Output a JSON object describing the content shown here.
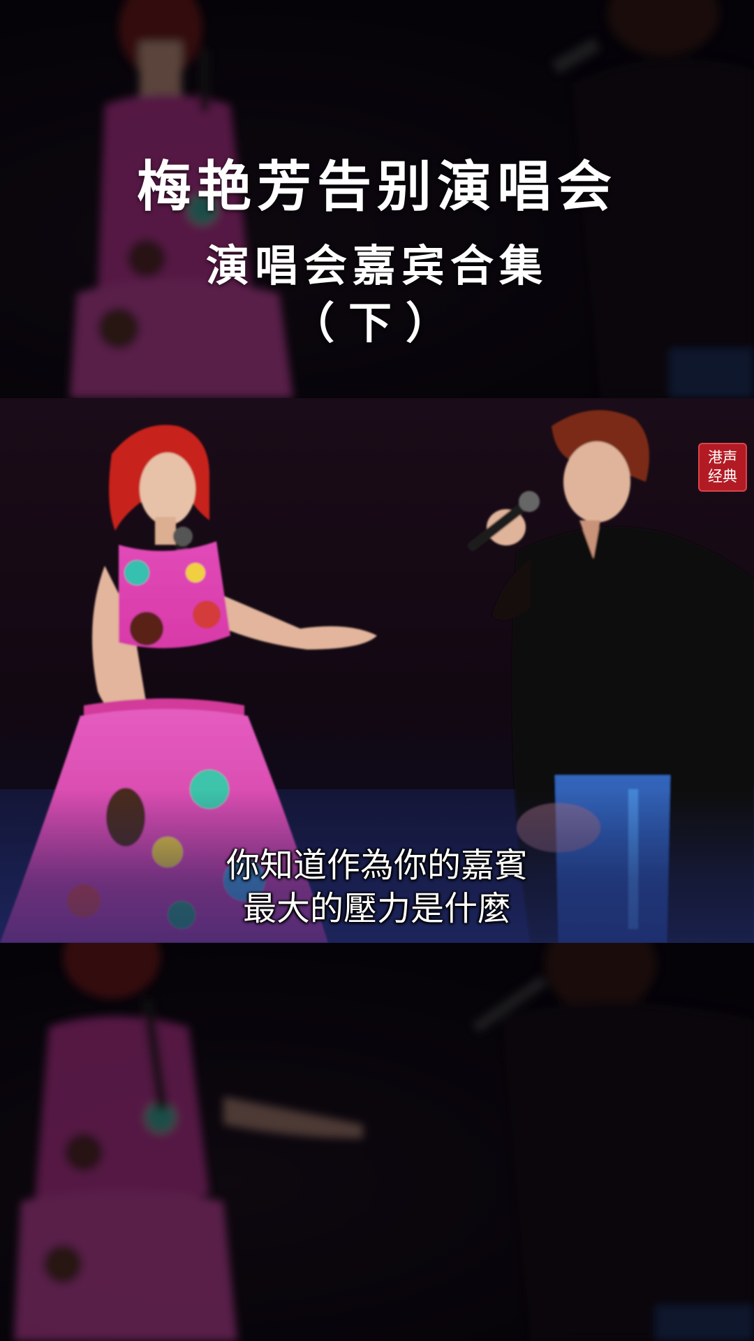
{
  "title": {
    "main": "梅艳芳告别演唱会",
    "sub": "演唱会嘉宾合集",
    "part": "（下）"
  },
  "subtitle": {
    "line1": "你知道作為你的嘉賓",
    "line2": "最大的壓力是什麼"
  },
  "watermark": {
    "line1": "港声",
    "line2": "经典"
  },
  "colors": {
    "dress": "#e040b8",
    "hair": "#c8201e",
    "badge": "#b31b24",
    "stage_blue": "#1e2a6a"
  }
}
